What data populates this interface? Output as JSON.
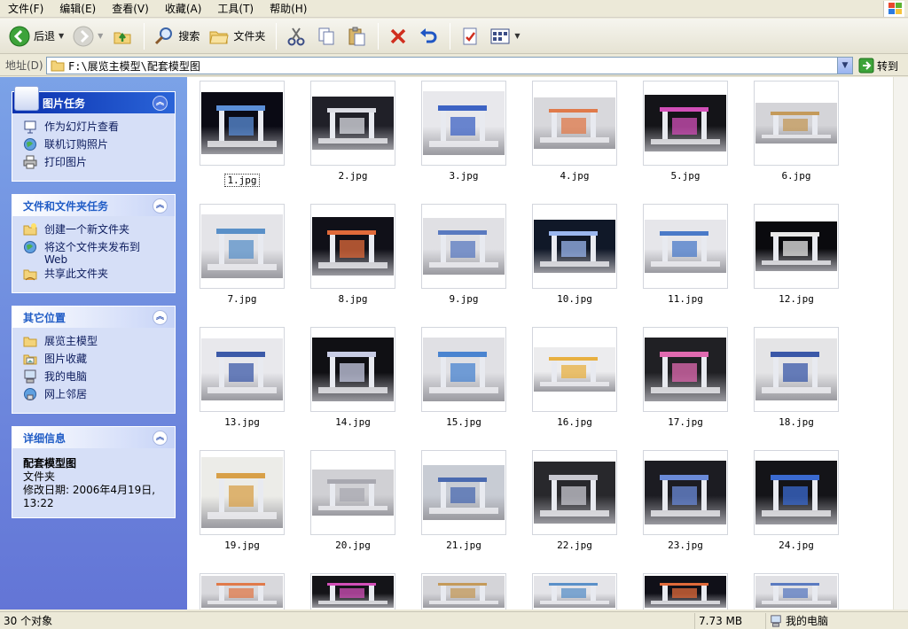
{
  "menu": [
    "文件(F)",
    "编辑(E)",
    "查看(V)",
    "收藏(A)",
    "工具(T)",
    "帮助(H)"
  ],
  "toolbar": {
    "back_label": "后退",
    "search_label": "搜索",
    "folders_label": "文件夹"
  },
  "address": {
    "label": "地址(D)",
    "value": "F:\\展览主模型\\配套模型图",
    "go_label": "转到"
  },
  "panels": {
    "picture_tasks": {
      "title": "图片任务",
      "items": [
        "作为幻灯片查看",
        "联机订购照片",
        "打印图片"
      ]
    },
    "file_tasks": {
      "title": "文件和文件夹任务",
      "items": [
        "创建一个新文件夹",
        "将这个文件夹发布到 Web",
        "共享此文件夹"
      ]
    },
    "other_places": {
      "title": "其它位置",
      "items": [
        "展览主模型",
        "图片收藏",
        "我的电脑",
        "网上邻居"
      ]
    },
    "details": {
      "title": "详细信息",
      "name": "配套模型图",
      "type": "文件夹",
      "modified": "修改日期: 2006年4月19日, 13:22"
    }
  },
  "files": [
    "1.jpg",
    "2.jpg",
    "3.jpg",
    "4.jpg",
    "5.jpg",
    "6.jpg",
    "7.jpg",
    "8.jpg",
    "9.jpg",
    "10.jpg",
    "11.jpg",
    "12.jpg",
    "13.jpg",
    "14.jpg",
    "15.jpg",
    "16.jpg",
    "17.jpg",
    "18.jpg",
    "19.jpg",
    "20.jpg",
    "21.jpg",
    "22.jpg",
    "23.jpg",
    "24.jpg"
  ],
  "status": {
    "count": "30 个对象",
    "size": "7.73 MB",
    "location": "我的电脑"
  },
  "colors": {
    "taskpane_top": "#7ba2e7",
    "taskpane_bottom": "#6375d6",
    "panel_title": "#215dc6",
    "link": "#0c1b5c"
  }
}
